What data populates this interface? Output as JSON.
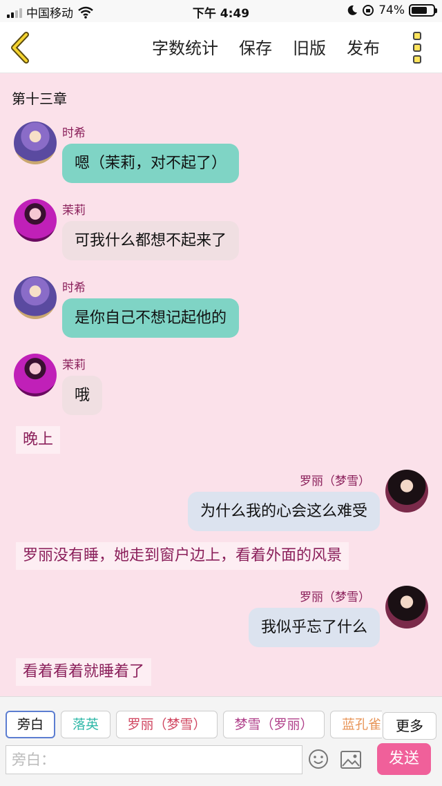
{
  "status_bar": {
    "carrier": "中国移动",
    "time": "下午 4:49",
    "battery": "74%",
    "battery_level": 0.74
  },
  "nav": {
    "back_icon": "chevron-left-icon",
    "word_count": "字数统计",
    "save": "保存",
    "old_version": "旧版",
    "publish": "发布",
    "menu_icon": "more-vertical-icon"
  },
  "chapter_title": "第十三章",
  "messages": [
    {
      "speaker": "时希",
      "text": "嗯（茉莉，对不起了）"
    },
    {
      "speaker": "茉莉",
      "text": "可我什么都想不起来了"
    },
    {
      "speaker": "时希",
      "text": "是你自己不想记起他的"
    },
    {
      "speaker": "茉莉",
      "text": "哦"
    },
    {
      "narration": "晚上"
    },
    {
      "speaker": "罗丽（梦雪）",
      "text": "为什么我的心会这么难受"
    },
    {
      "narration": "罗丽没有睡，她走到窗户边上，看着外面的风景"
    },
    {
      "speaker": "罗丽（梦雪）",
      "text": "我似乎忘了什么"
    },
    {
      "narration": "看着看着就睡着了"
    }
  ],
  "roles": [
    {
      "label": "旁白",
      "color": "#111111"
    },
    {
      "label": "落英",
      "color": "#2fb8a8"
    },
    {
      "label": "罗丽（梦雪）",
      "color": "#d0455f"
    },
    {
      "label": "梦雪（罗丽）",
      "color": "#b0408a"
    },
    {
      "label": "蓝孔雀",
      "color": "#e8965a"
    }
  ],
  "more_button": "更多",
  "input": {
    "placeholder": "旁白："
  },
  "send_button": "发送",
  "colors": {
    "background": "#fbe1ea",
    "left_bubble_shixi": "#7fd4c5",
    "left_bubble_moli": "#f0dfe2",
    "right_bubble": "#dce3ef",
    "speaker_name": "#8a1f5a",
    "send": "#f0609a"
  }
}
